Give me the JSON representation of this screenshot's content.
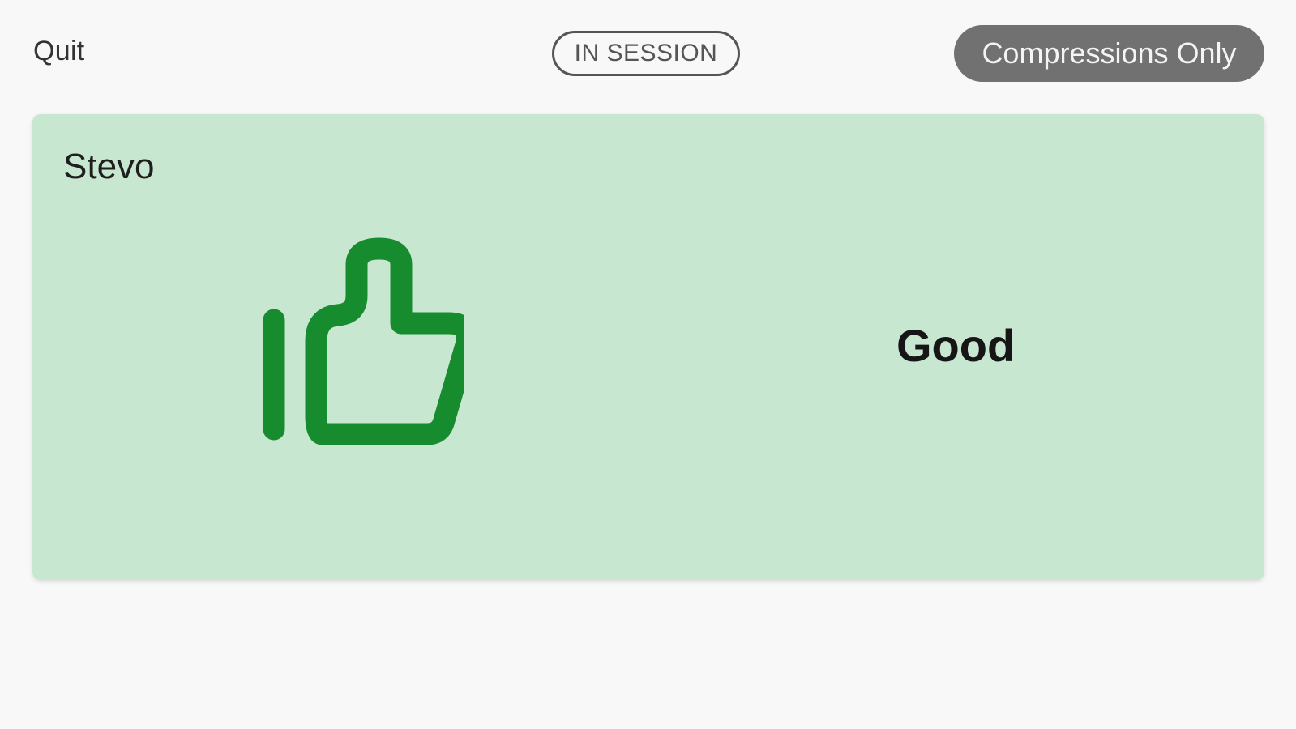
{
  "header": {
    "quit_label": "Quit",
    "status_label": "IN SESSION",
    "mode_label": "Compressions Only"
  },
  "card": {
    "name": "Stevo",
    "result_label": "Good",
    "icon": "thumbs-up-icon",
    "background_color": "#c8e7d0",
    "icon_color": "#168c2e"
  }
}
